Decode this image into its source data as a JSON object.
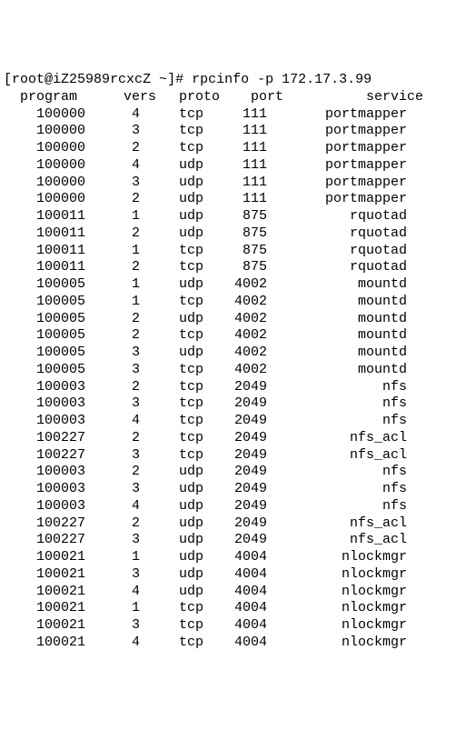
{
  "prompt": {
    "user": "root",
    "host": "iZ25989rcxcZ",
    "path": "~",
    "symbol": "#",
    "command": "rpcinfo -p 172.17.3.99"
  },
  "header": {
    "program": "program",
    "vers": "vers",
    "proto": "proto",
    "port": "port",
    "service": "service"
  },
  "rows": [
    {
      "program": "100000",
      "vers": "4",
      "proto": "tcp",
      "port": "111",
      "service": "portmapper"
    },
    {
      "program": "100000",
      "vers": "3",
      "proto": "tcp",
      "port": "111",
      "service": "portmapper"
    },
    {
      "program": "100000",
      "vers": "2",
      "proto": "tcp",
      "port": "111",
      "service": "portmapper"
    },
    {
      "program": "100000",
      "vers": "4",
      "proto": "udp",
      "port": "111",
      "service": "portmapper"
    },
    {
      "program": "100000",
      "vers": "3",
      "proto": "udp",
      "port": "111",
      "service": "portmapper"
    },
    {
      "program": "100000",
      "vers": "2",
      "proto": "udp",
      "port": "111",
      "service": "portmapper"
    },
    {
      "program": "100011",
      "vers": "1",
      "proto": "udp",
      "port": "875",
      "service": "rquotad"
    },
    {
      "program": "100011",
      "vers": "2",
      "proto": "udp",
      "port": "875",
      "service": "rquotad"
    },
    {
      "program": "100011",
      "vers": "1",
      "proto": "tcp",
      "port": "875",
      "service": "rquotad"
    },
    {
      "program": "100011",
      "vers": "2",
      "proto": "tcp",
      "port": "875",
      "service": "rquotad"
    },
    {
      "program": "100005",
      "vers": "1",
      "proto": "udp",
      "port": "4002",
      "service": "mountd"
    },
    {
      "program": "100005",
      "vers": "1",
      "proto": "tcp",
      "port": "4002",
      "service": "mountd"
    },
    {
      "program": "100005",
      "vers": "2",
      "proto": "udp",
      "port": "4002",
      "service": "mountd"
    },
    {
      "program": "100005",
      "vers": "2",
      "proto": "tcp",
      "port": "4002",
      "service": "mountd"
    },
    {
      "program": "100005",
      "vers": "3",
      "proto": "udp",
      "port": "4002",
      "service": "mountd"
    },
    {
      "program": "100005",
      "vers": "3",
      "proto": "tcp",
      "port": "4002",
      "service": "mountd"
    },
    {
      "program": "100003",
      "vers": "2",
      "proto": "tcp",
      "port": "2049",
      "service": "nfs"
    },
    {
      "program": "100003",
      "vers": "3",
      "proto": "tcp",
      "port": "2049",
      "service": "nfs"
    },
    {
      "program": "100003",
      "vers": "4",
      "proto": "tcp",
      "port": "2049",
      "service": "nfs"
    },
    {
      "program": "100227",
      "vers": "2",
      "proto": "tcp",
      "port": "2049",
      "service": "nfs_acl"
    },
    {
      "program": "100227",
      "vers": "3",
      "proto": "tcp",
      "port": "2049",
      "service": "nfs_acl"
    },
    {
      "program": "100003",
      "vers": "2",
      "proto": "udp",
      "port": "2049",
      "service": "nfs"
    },
    {
      "program": "100003",
      "vers": "3",
      "proto": "udp",
      "port": "2049",
      "service": "nfs"
    },
    {
      "program": "100003",
      "vers": "4",
      "proto": "udp",
      "port": "2049",
      "service": "nfs"
    },
    {
      "program": "100227",
      "vers": "2",
      "proto": "udp",
      "port": "2049",
      "service": "nfs_acl"
    },
    {
      "program": "100227",
      "vers": "3",
      "proto": "udp",
      "port": "2049",
      "service": "nfs_acl"
    },
    {
      "program": "100021",
      "vers": "1",
      "proto": "udp",
      "port": "4004",
      "service": "nlockmgr"
    },
    {
      "program": "100021",
      "vers": "3",
      "proto": "udp",
      "port": "4004",
      "service": "nlockmgr"
    },
    {
      "program": "100021",
      "vers": "4",
      "proto": "udp",
      "port": "4004",
      "service": "nlockmgr"
    },
    {
      "program": "100021",
      "vers": "1",
      "proto": "tcp",
      "port": "4004",
      "service": "nlockmgr"
    },
    {
      "program": "100021",
      "vers": "3",
      "proto": "tcp",
      "port": "4004",
      "service": "nlockmgr"
    },
    {
      "program": "100021",
      "vers": "4",
      "proto": "tcp",
      "port": "4004",
      "service": "nlockmgr"
    }
  ]
}
